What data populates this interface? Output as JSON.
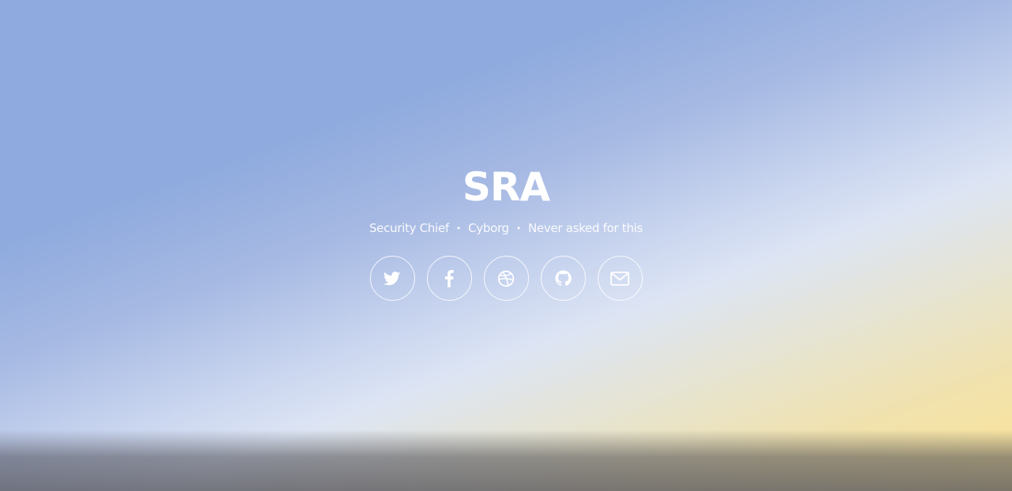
{
  "header": {
    "title": "SRA",
    "tagline": [
      "Security Chief",
      "Cyborg",
      "Never asked for this"
    ],
    "separator": "•"
  },
  "socials": [
    {
      "name": "twitter",
      "icon": "twitter-icon"
    },
    {
      "name": "facebook",
      "icon": "facebook-icon"
    },
    {
      "name": "dribbble",
      "icon": "dribbble-icon"
    },
    {
      "name": "github",
      "icon": "github-icon"
    },
    {
      "name": "email",
      "icon": "envelope-icon"
    }
  ],
  "colors": {
    "text": "#ffffff",
    "gradient_start": "#8eaade",
    "gradient_end": "#fde597"
  }
}
